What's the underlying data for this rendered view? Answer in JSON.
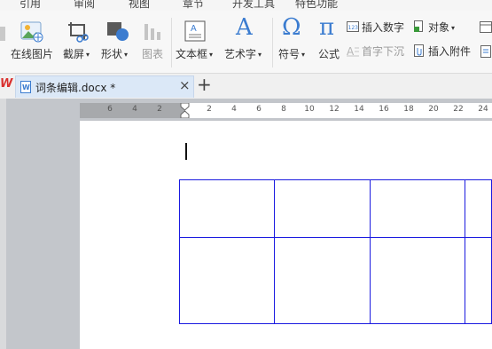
{
  "menu": [
    "引用",
    "审阅",
    "视图",
    "章节",
    "开发工具",
    "特色功能"
  ],
  "ribbon": {
    "online_pic": "在线图片",
    "screenshot": "截屏",
    "shapes": "形状",
    "chart": "图表",
    "textbox": "文本框",
    "wordart": "艺术字",
    "symbol": "符号",
    "formula": "公式",
    "insert_number": "插入数字",
    "object": "对象",
    "dropcap": "首字下沉",
    "insert_attachment": "插入附件",
    "wordart_glyph": "A",
    "symbol_glyph": "Ω",
    "formula_glyph": "π"
  },
  "tabs": {
    "app_logo": "W",
    "doc_title": "词条编辑.docx *",
    "close": "×",
    "new_tab": "+"
  },
  "ruler": {
    "left_numbers": [
      "6",
      "4",
      "2"
    ],
    "right_numbers": [
      "2",
      "4",
      "6",
      "8",
      "10",
      "12",
      "14",
      "16",
      "18",
      "20",
      "22",
      "24"
    ]
  },
  "colors": {
    "accent": "#3b7cd0",
    "table_border": "#1a1ae0",
    "tab_active": "#dbe8f7",
    "workspace": "#c3c6cb"
  }
}
